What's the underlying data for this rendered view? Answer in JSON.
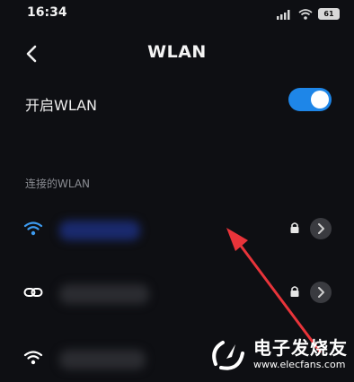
{
  "status_bar": {
    "time": "16:34",
    "battery": "61",
    "signal_icon": "signal-bars-icon",
    "wifi_icon": "wifi-icon"
  },
  "header": {
    "back_icon": "chevron-left-icon",
    "title": "WLAN"
  },
  "wlan_toggle": {
    "label": "开启WLAN",
    "state": "on",
    "accent_color": "#1e86e8"
  },
  "connected_section": {
    "label": "连接的WLAN"
  },
  "networks": [
    {
      "name_visible": false,
      "icon": "wifi-icon",
      "icon_color": "#3d9bf0",
      "locked": true,
      "detail_icon": "chevron-right-icon"
    },
    {
      "name_visible": false,
      "icon": "link-icon",
      "icon_color": "#ffffff",
      "locked": true,
      "detail_icon": "chevron-right-icon"
    },
    {
      "name_visible": false,
      "icon": "wifi-icon",
      "icon_color": "#ffffff",
      "locked": false
    }
  ],
  "annotation": {
    "arrow_color": "#e8343a"
  },
  "watermark": {
    "brand": "电子发烧友",
    "url": "www.elecfans.com"
  }
}
